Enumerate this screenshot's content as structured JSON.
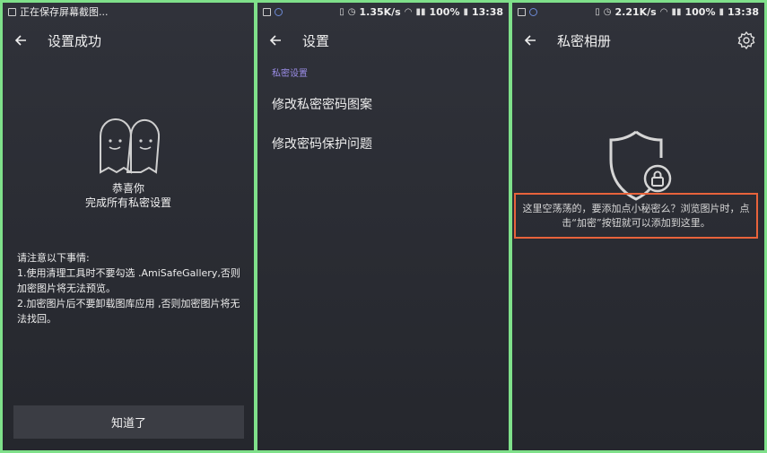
{
  "panel1": {
    "status": {
      "text": "正在保存屏幕截图..."
    },
    "title": "设置成功",
    "congrats_line1": "恭喜你",
    "congrats_line2": "完成所有私密设置",
    "notes_title": "请注意以下事情:",
    "note1": "1.使用清理工具时不要勾选 .AmiSafeGallery,否则加密图片将无法预览。",
    "note2": "2.加密图片后不要卸载图库应用 ,否则加密图片将无法找回。",
    "button_label": "知道了"
  },
  "panel2": {
    "status": {
      "speed": "1.35K/s",
      "battery": "100%",
      "time": "13:38"
    },
    "title": "设置",
    "section_header": "私密设置",
    "items": [
      {
        "label": "修改私密密码图案"
      },
      {
        "label": "修改密码保护问题"
      }
    ]
  },
  "panel3": {
    "status": {
      "speed": "2.21K/s",
      "battery": "100%",
      "time": "13:38"
    },
    "title": "私密相册",
    "empty_message": "这里空荡荡的，要添加点小秘密么？浏览图片时，点击“加密”按钮就可以添加到这里。"
  },
  "icons": {
    "back": "back-arrow-icon",
    "gear": "gear-icon",
    "ghost": "ghost-pair-icon",
    "shield": "shield-lock-icon"
  },
  "colors": {
    "background": "#2b2d33",
    "accent_purple": "#9a8ce6",
    "highlight_orange": "#e8633b",
    "frame_green": "#7fe08a"
  }
}
